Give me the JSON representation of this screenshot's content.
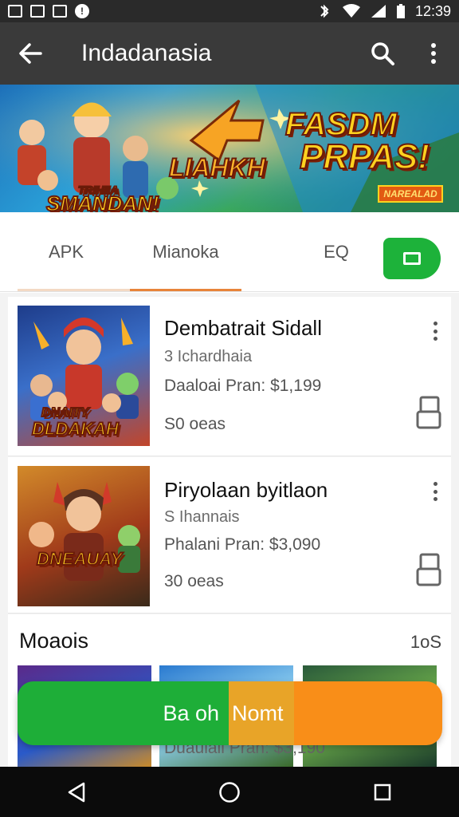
{
  "status_bar": {
    "time": "12:39"
  },
  "app_bar": {
    "title": "Indadanasia"
  },
  "banner": {
    "headline_1": "FASDM",
    "headline_2": "PRPAS!",
    "tag": "NAREALAD",
    "center_word": "LIAHKH",
    "left_word_1": "TRIHIIA",
    "left_word_2": "SMANDAN!"
  },
  "tabs": [
    {
      "label": "APK"
    },
    {
      "label": "Mianoka"
    },
    {
      "label": "EQ"
    }
  ],
  "items": [
    {
      "title": "Dembatrait Sidall",
      "subtitle": "3 Ichardhaia",
      "price": "Daaloai Pran: $1,199",
      "meta": "S0 oeas",
      "thumb_text_1": "DNAITY",
      "thumb_text_2": "DLDAKAH"
    },
    {
      "title": "Piryolaan byitlaon",
      "subtitle": "S Ihannais",
      "price": "Phalani Pran: $3,090",
      "meta": "30 oeas",
      "thumb_text_1": "DNEAUAY"
    }
  ],
  "section": {
    "title": "Moaois",
    "count": "1oS"
  },
  "grid_price": "Duaulali Pran: $3,190",
  "cta": {
    "left_label": "Ba oh",
    "right_label": "Nomt"
  },
  "colors": {
    "accent_green": "#1db23a",
    "accent_orange": "#f98e18",
    "tab_underline": "#e8843a"
  }
}
